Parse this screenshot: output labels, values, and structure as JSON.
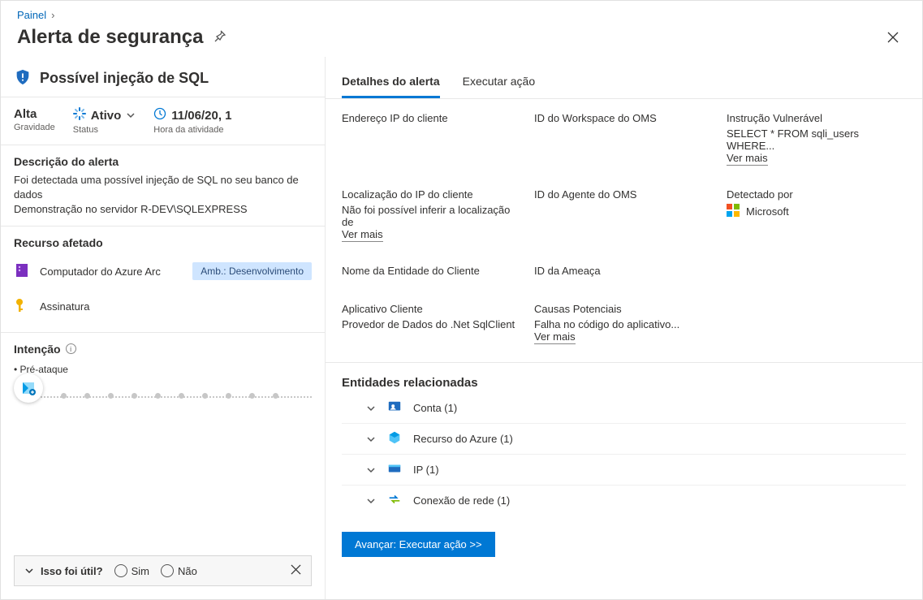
{
  "breadcrumb": {
    "root": "Painel"
  },
  "page_title": "Alerta de segurança",
  "alert": {
    "name": "Possível injeção de SQL",
    "severity_value": "Alta",
    "severity_label": "Gravidade",
    "status_value": "Ativo",
    "status_label": "Status",
    "time_value": "11/06/20, 1",
    "time_label": "Hora da atividade"
  },
  "description": {
    "title": "Descrição do alerta",
    "line1": "Foi detectada uma possível injeção de SQL no seu banco de dados",
    "line2": "Demonstração no servidor R-DEV\\SQLEXPRESS"
  },
  "affected": {
    "title": "Recurso afetado",
    "resource_label": "Computador do Azure Arc",
    "resource_badge": "Amb.: Desenvolvimento",
    "subscription_label": "Assinatura"
  },
  "intent": {
    "title": "Intenção",
    "stage": "Pré-ataque"
  },
  "feedback": {
    "question": "Isso foi útil?",
    "yes": "Sim",
    "no": "Não"
  },
  "tabs": {
    "details": "Detalhes do alerta",
    "action": "Executar ação"
  },
  "details": {
    "client_ip_label": "Endereço IP do cliente",
    "client_ip_loc_label": "Localização do IP do cliente",
    "client_ip_loc_value": "Não foi possível inferir a localização de",
    "client_entity_label": "Nome da Entidade do Cliente",
    "client_app_label": "Aplicativo Cliente",
    "client_app_value": "Provedor de Dados do .Net SqlClient",
    "oms_ws_label": "ID do Workspace do OMS",
    "oms_agent_label": "ID do Agente do OMS",
    "threat_id_label": "ID da Ameaça",
    "causes_label": "Causas Potenciais",
    "causes_value": "Falha no código do aplicativo...",
    "vuln_stmt_label": "Instrução Vulnerável",
    "vuln_stmt_value": "SELECT * FROM sqli_users WHERE...",
    "detected_by_label": "Detectado por",
    "detected_by_value": "Microsoft",
    "see_more": "Ver mais"
  },
  "related": {
    "title": "Entidades relacionadas",
    "items": [
      {
        "label": "Conta (1)"
      },
      {
        "label": "Recurso do Azure (1)"
      },
      {
        "label": "IP (1)"
      },
      {
        "label": "Conexão de rede (1)"
      }
    ]
  },
  "primary_action": "Avançar: Executar ação  >>"
}
